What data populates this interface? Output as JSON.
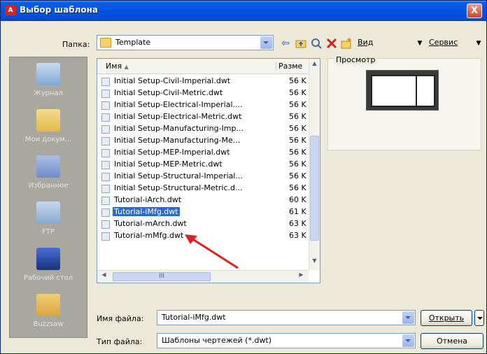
{
  "title": "Выбор шаблона",
  "close_symbol": "X",
  "folder": {
    "label": "Папка:",
    "value": "Template"
  },
  "toolbar": {
    "view_label": "Вид",
    "tools_label": "Сервис"
  },
  "places": [
    {
      "label": "Журнал",
      "icon": "history-icon",
      "color": "#7fa7d6"
    },
    {
      "label": "Мои докум...",
      "icon": "my-documents-icon",
      "color": "#e3b84a"
    },
    {
      "label": "Избранное",
      "icon": "favorites-icon",
      "color": "#6e8ec5"
    },
    {
      "label": "FTP",
      "icon": "ftp-icon",
      "color": "#86a9cf"
    },
    {
      "label": "Рабочий стол",
      "icon": "desktop-icon",
      "color": "#2b4aa8"
    },
    {
      "label": "Buzzsaw",
      "icon": "buzzsaw-icon",
      "color": "#d9a53a"
    }
  ],
  "columns": {
    "name": "Имя",
    "size": "Разме"
  },
  "files": [
    {
      "name": "Initial Setup-Civil-Imperial.dwt",
      "size": "56 K"
    },
    {
      "name": "Initial Setup-Civil-Metric.dwt",
      "size": "56 K"
    },
    {
      "name": "Initial Setup-Electrical-Imperial....",
      "size": "56 K"
    },
    {
      "name": "Initial Setup-Electrical-Metric.dwt",
      "size": "56 K"
    },
    {
      "name": "Initial Setup-Manufacturing-Imp...",
      "size": "56 K"
    },
    {
      "name": "Initial Setup-Manufacturing-Me...",
      "size": "56 K"
    },
    {
      "name": "Initial Setup-MEP-Imperial.dwt",
      "size": "56 K"
    },
    {
      "name": "Initial Setup-MEP-Metric.dwt",
      "size": "56 K"
    },
    {
      "name": "Initial Setup-Structural-Imperial...",
      "size": "56 K"
    },
    {
      "name": "Initial Setup-Structural-Metric.d...",
      "size": "56 K"
    },
    {
      "name": "Tutorial-iArch.dwt",
      "size": "60 K"
    },
    {
      "name": "Tutorial-iMfg.dwt",
      "size": "61 K"
    },
    {
      "name": "Tutorial-mArch.dwt",
      "size": "63 K"
    },
    {
      "name": "Tutorial-mMfg.dwt",
      "size": "63 K"
    }
  ],
  "hscroll_grip": "III",
  "preview_label": "Просмотр",
  "filename": {
    "label": "Имя файла:",
    "value": "Tutorial-iMfg.dwt"
  },
  "filetype": {
    "label": "Тип файла:",
    "value": "Шаблоны чертежей (*.dwt)"
  },
  "buttons": {
    "open": "Открыть",
    "cancel": "Отмена"
  },
  "colors": {
    "selection": "#316ac5",
    "arrow": "#e02020",
    "title_bar": "#0054e3"
  }
}
